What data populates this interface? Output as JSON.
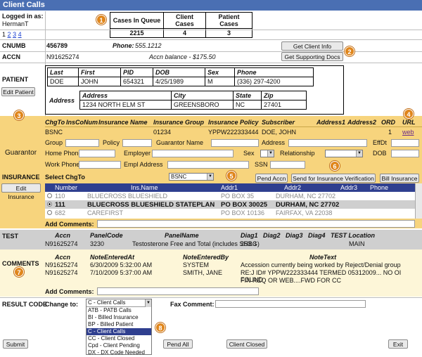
{
  "window": {
    "title": "Client Calls"
  },
  "logged_in": {
    "label": "Logged in as:",
    "user": "HermanT"
  },
  "queue_stats": {
    "headers": [
      "Cases In Queue",
      "Client Cases",
      "Patient Cases"
    ],
    "values": [
      "2215",
      "4",
      "3"
    ]
  },
  "pager": [
    "1",
    "2",
    "3",
    "4"
  ],
  "markers": [
    "1",
    "2",
    "3",
    "4",
    "5",
    "6",
    "7",
    "8"
  ],
  "cnumb": {
    "label": "CNUMB",
    "value": "456789",
    "phone_label": "Phone:",
    "phone": "555.1212"
  },
  "accn": {
    "label": "ACCN",
    "value": "N91625274",
    "balance": "Accn balance - $175.50"
  },
  "buttons": {
    "get_client_info": "Get Client Info",
    "get_supporting_docs": "Get Supporting Docs",
    "edit_patient": "Edit Patient",
    "pend_accn": "Pend Accn",
    "send_verification": "Send for Insurance Verification",
    "bill_insurance": "Bill Insurance",
    "edit_insurance": "Edit Insurance",
    "submit": "Submit",
    "pend_all": "Pend All",
    "client_closed": "Client Closed",
    "exit": "Exit"
  },
  "patient": {
    "label": "PATIENT",
    "headers": [
      "Last",
      "First",
      "PID",
      "DOB",
      "Sex",
      "Phone"
    ],
    "values": [
      "DOE",
      "JOHN",
      "654321",
      "4/25/1989",
      "M",
      "(336) 297-4200"
    ],
    "address_label": "Address",
    "address_headers": [
      "Address",
      "City",
      "State",
      "Zip"
    ],
    "address_values": [
      "1234 NORTH ELM ST",
      "GREENSBORO",
      "NC",
      "27401"
    ]
  },
  "guarantor": {
    "label": "Guarantor",
    "headers": [
      "ChgTo",
      "InsCoNum",
      "Insurance Name",
      "Insurance Group",
      "Insurance Policy",
      "Subscriber",
      "Address1",
      "Address2",
      "ORD",
      "URL"
    ],
    "values": [
      "BSNC",
      "",
      "",
      "01234",
      "YPPW222333444",
      "DOE, JOHN",
      "",
      "",
      "1",
      "web"
    ],
    "fields_row1": [
      "Group",
      "Policy",
      "Guarantor Name",
      "Address",
      "EffDt"
    ],
    "fields_row2": [
      "Home Phone",
      "Employer",
      "Sex",
      "Relationship",
      "DOB"
    ],
    "fields_row3": [
      "Work Phone",
      "Empl Address",
      "SSN"
    ]
  },
  "insurance": {
    "label": "INSURANCE",
    "select_label": "Select ChgTo",
    "select_value": "BSNC",
    "headers": [
      "Number",
      "Ins.Name",
      "Addr1",
      "Addr2",
      "Addr3",
      "Phone"
    ],
    "rows": [
      {
        "number": "110",
        "name": "BLUECROSS BLUESHIELD",
        "addr1": "PO BOX 35",
        "addr2": "DURHAM, NC 27702",
        "addr3": "",
        "phone": "",
        "selected": false
      },
      {
        "number": "111",
        "name": "BLUECROSS BLUESHIELD STATEPLAN",
        "addr1": "PO BOX 30025",
        "addr2": "DURHAM, NC 27702",
        "addr3": "",
        "phone": "",
        "selected": true
      },
      {
        "number": "682",
        "name": "CAREFIRST",
        "addr1": "PO BOX 10136",
        "addr2": "FAIRFAX, VA 22038",
        "addr3": "",
        "phone": "",
        "selected": false
      }
    ],
    "add_comments_label": "Add Comments:"
  },
  "test": {
    "label": "TEST",
    "headers": [
      "Accn",
      "PanelCode",
      "PanelName",
      "Diag1",
      "Diag2",
      "Diag3",
      "Diag4",
      "TEST Location"
    ],
    "values": [
      "N91625274",
      "3230",
      "Testosterone Free and Total (includes SHBG)",
      "253.3",
      "",
      "",
      "",
      "MAIN"
    ]
  },
  "comments": {
    "label": "COMMENTS",
    "headers": [
      "Accn",
      "NoteEnteredAt",
      "NoteEnteredBy",
      "NoteText"
    ],
    "rows": [
      {
        "accn": "N91625274",
        "at": "6/30/2009 5:32:00 AM",
        "by": "SYSTEM",
        "text1": "Accession currently being worked by Reject/Denial group",
        "text2": ""
      },
      {
        "accn": "N91625274",
        "at": "7/10/2009 5:37:00 AM",
        "by": "SMITH, JANE",
        "text1": "RE:J ID# YPPW222333444 TERMED 05312009... NO OI FOUND",
        "text2": "FIN REQ OR WEB....FWD FOR CC"
      }
    ],
    "add_comments_label": "Add Comments:"
  },
  "result_code": {
    "label": "RESULT CODE",
    "change_to_label": "Change to:",
    "selected": "C - Client Calls",
    "options": [
      "ATB - PATB Calls",
      "BI - Billed Insurance",
      "BP - Billed Patient",
      "C - Client Calls",
      "CC - Client Closed",
      "Cpd - Client Pending",
      "DX - DX Code Needed"
    ],
    "fax_label": "Fax Comment:"
  }
}
